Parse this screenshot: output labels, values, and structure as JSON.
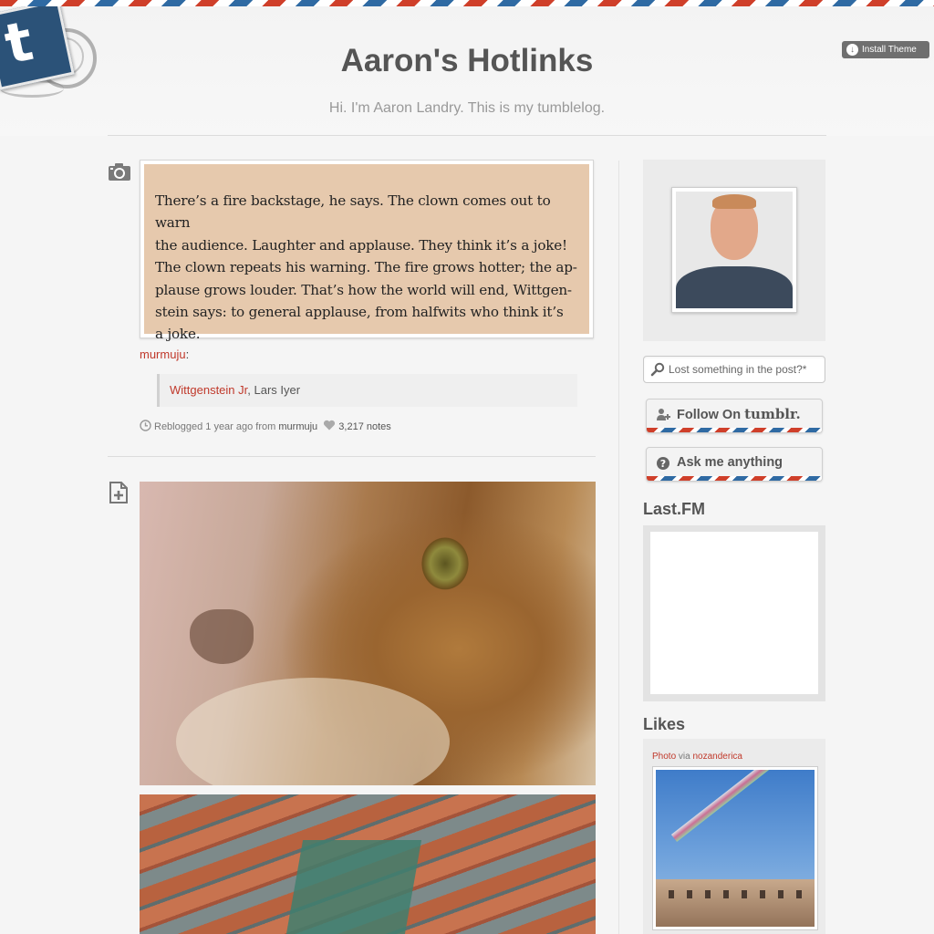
{
  "header": {
    "site_title": "Aaron's Hotlinks",
    "description": "Hi. I'm Aaron Landry. This is my tumblelog.",
    "install_theme_label": "Install Theme",
    "stamp_letter": "t"
  },
  "posts": [
    {
      "type": "photo",
      "icon": "camera-icon",
      "book_lines": [
        "There’s a fire backstage, he says. The clown comes out to warn",
        "the audience. Laughter and applause. They think it’s a joke!",
        "The clown repeats his warning. The fire grows hotter; the ap-",
        "plause grows louder. That’s how the world will end, Wittgen-",
        "stein says: to general applause, from halfwits who think it’s",
        "a joke."
      ],
      "source_user": "murmuju",
      "source_suffix": ":",
      "quote_link": "Wittgenstein Jr",
      "quote_rest": ", Lars Iyer",
      "meta": {
        "reblogged": "Reblogged 1 year ago from",
        "from_user": "murmuju",
        "notes": "3,217 notes"
      }
    },
    {
      "type": "photoset",
      "icon": "text-post-icon"
    }
  ],
  "sidebar": {
    "search_placeholder": "Lost something in the post?*",
    "follow_label": "Follow On",
    "follow_brand": "tumblr.",
    "ask_label": "Ask me anything",
    "lastfm_heading": "Last.FM",
    "likes_heading": "Likes",
    "like": {
      "type_label": "Photo",
      "via": "via",
      "user": "nozanderica"
    }
  },
  "colors": {
    "accent_red": "#c0392b",
    "airmail_red": "#cf3f2a",
    "airmail_blue": "#2f6aa3",
    "stamp_blue": "#2b5278"
  }
}
